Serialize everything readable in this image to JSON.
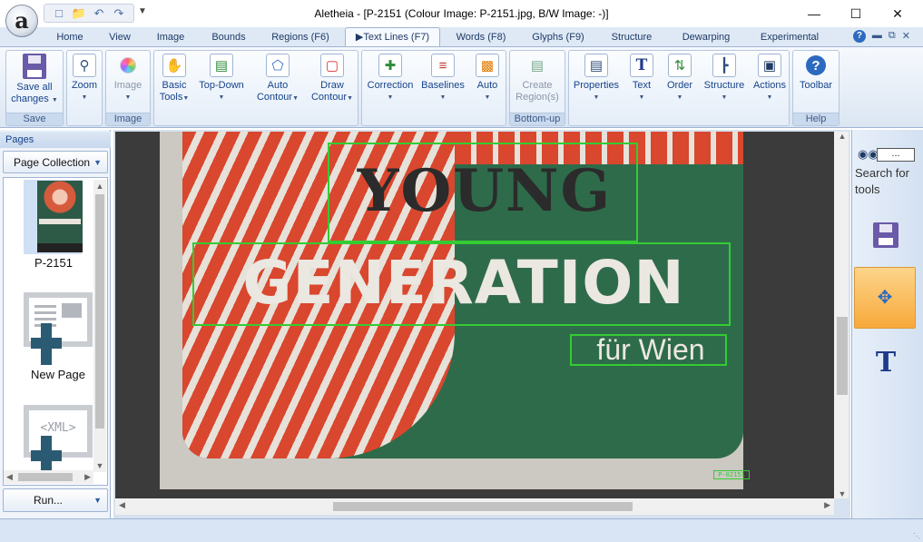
{
  "title_bar": {
    "window_title": "Aletheia - [P-2151   (Colour Image: P-2151.jpg,  B/W Image: -)]",
    "app_icon_letter": "a",
    "minimize_glyph": "—",
    "maximize_glyph": "☐",
    "close_glyph": "✕"
  },
  "tabs": [
    {
      "label": "Home"
    },
    {
      "label": "View"
    },
    {
      "label": "Image"
    },
    {
      "label": "Bounds"
    },
    {
      "label": "Regions (F6)"
    },
    {
      "label": "▶Text Lines (F7)",
      "active": true
    },
    {
      "label": "Words (F8)"
    },
    {
      "label": "Glyphs (F9)"
    },
    {
      "label": "Structure"
    },
    {
      "label": "Dewarping"
    },
    {
      "label": "Experimental"
    }
  ],
  "ribbon": {
    "groups": [
      {
        "label": "Save"
      },
      {
        "label": "Image"
      },
      {
        "label": ""
      },
      {
        "label": "Bottom-up"
      },
      {
        "label": ""
      },
      {
        "label": "Help"
      }
    ],
    "buttons": [
      {
        "label1": "Save all",
        "label2": "changes",
        "icon": "floppy-disk-icon",
        "disabled": false
      },
      {
        "label1": "Zoom",
        "label2": "",
        "icon": "magnifier-icon",
        "disabled": false
      },
      {
        "label1": "Image",
        "label2": "",
        "icon": "color-wheel-icon",
        "disabled": true
      },
      {
        "label1": "Basic",
        "label2": "Tools",
        "icon": "hand-icon",
        "disabled": false
      },
      {
        "label1": "Top-Down",
        "label2": "",
        "icon": "image-lines-icon",
        "disabled": false
      },
      {
        "label1": "Auto",
        "label2": "Contour",
        "icon": "auto-contour-icon",
        "disabled": false
      },
      {
        "label1": "Draw",
        "label2": "Contour",
        "icon": "draw-rect-icon",
        "disabled": false
      },
      {
        "label1": "Correction",
        "label2": "",
        "icon": "correction-icon",
        "disabled": false
      },
      {
        "label1": "Baselines",
        "label2": "",
        "icon": "baselines-icon",
        "disabled": false
      },
      {
        "label1": "Auto",
        "label2": "",
        "icon": "auto-icon",
        "disabled": false
      },
      {
        "label1": "Create",
        "label2": "Region(s)",
        "icon": "create-region-icon",
        "disabled": true
      },
      {
        "label1": "Properties",
        "label2": "",
        "icon": "properties-icon",
        "disabled": false
      },
      {
        "label1": "Text",
        "label2": "",
        "icon": "text-t-icon",
        "disabled": false
      },
      {
        "label1": "Order",
        "label2": "",
        "icon": "order-icon",
        "disabled": false
      },
      {
        "label1": "Structure",
        "label2": "",
        "icon": "structure-icon",
        "disabled": false
      },
      {
        "label1": "Actions",
        "label2": "",
        "icon": "actions-icon",
        "disabled": false
      },
      {
        "label1": "Toolbar",
        "label2": "",
        "icon": "help-icon",
        "disabled": false
      }
    ]
  },
  "left_panel": {
    "header": "Pages",
    "collection_select": "Page Collection",
    "thumbnails": [
      {
        "label": "P-2151"
      },
      {
        "label": "New Page"
      },
      {
        "label": ""
      }
    ],
    "xml_label": "<XML>",
    "run_button": "Run..."
  },
  "canvas": {
    "line_text_1": "YOUNG",
    "line_text_2": "GENERATION",
    "line_text_3": "für Wien",
    "page_id_text": "P-02151"
  },
  "right_panel": {
    "search_label": "Search for tools",
    "search_value": "..."
  },
  "colors": {
    "accent": "#15428b",
    "ribbon_bg": "#dbe6f3",
    "poster_red": "#d9472e",
    "poster_green": "#2e6b4a",
    "line_box": "#33cc33",
    "selected_tool": "#f9b44a"
  }
}
